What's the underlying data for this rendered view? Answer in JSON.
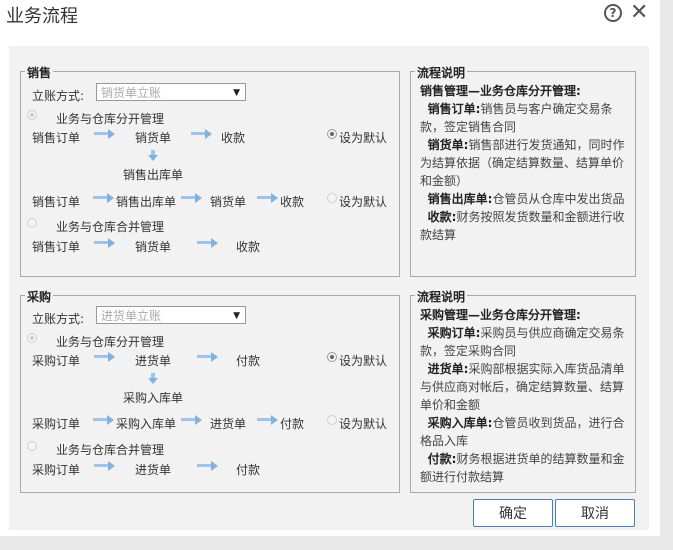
{
  "dialog": {
    "title": "业务流程",
    "help_label": "?",
    "close_label": "✕",
    "ok_label": "确定",
    "cancel_label": "取消"
  },
  "sales": {
    "legend": "销售",
    "mode_label": "立账方式:",
    "mode_value": "销货单立账",
    "separate": {
      "label": "业务与仓库分开管理",
      "row1": [
        "销售订单",
        "销货单",
        "收款"
      ],
      "row1_down": "销售出库单",
      "row2": [
        "销售订单",
        "销售出库单",
        "销货单",
        "收款"
      ]
    },
    "default1_label": "设为默认",
    "default2_label": "设为默认",
    "merged": {
      "label": "业务与仓库合并管理",
      "row": [
        "销售订单",
        "销货单",
        "收款"
      ]
    },
    "info": {
      "legend": "流程说明",
      "heading": "销售管理—业务仓库分开管理:",
      "items": [
        {
          "key": "销售订单:",
          "text": "销售员与客户确定交易条款，签定销售合同"
        },
        {
          "key": "销货单:",
          "text": "销售部进行发货通知，同时作为结算依据（确定结算数量、结算单价和金额）"
        },
        {
          "key": "销售出库单:",
          "text": "仓管员从仓库中发出货品"
        },
        {
          "key": "收款:",
          "text": "财务按照发货数量和金额进行收款结算"
        }
      ]
    }
  },
  "purchase": {
    "legend": "采购",
    "mode_label": "立账方式:",
    "mode_value": "进货单立账",
    "separate": {
      "label": "业务与仓库分开管理",
      "row1": [
        "采购订单",
        "进货单",
        "付款"
      ],
      "row1_down": "采购入库单",
      "row2": [
        "采购订单",
        "采购入库单",
        "进货单",
        "付款"
      ]
    },
    "default1_label": "设为默认",
    "default2_label": "设为默认",
    "merged": {
      "label": "业务与仓库合并管理",
      "row": [
        "采购订单",
        "进货单",
        "付款"
      ]
    },
    "info": {
      "legend": "流程说明",
      "heading": "采购管理—业务仓库分开管理:",
      "items": [
        {
          "key": "采购订单:",
          "text": "采购员与供应商确定交易条款，签定采购合同"
        },
        {
          "key": "进货单:",
          "text": "采购部根据实际入库货品清单与供应商对帐后，确定结算数量、结算单价和金额"
        },
        {
          "key": "采购入库单:",
          "text": "仓管员收到货品，进行合格品入库"
        },
        {
          "key": "付款:",
          "text": "财务根据进货单的结算数量和金额进行付款结算"
        }
      ]
    }
  }
}
